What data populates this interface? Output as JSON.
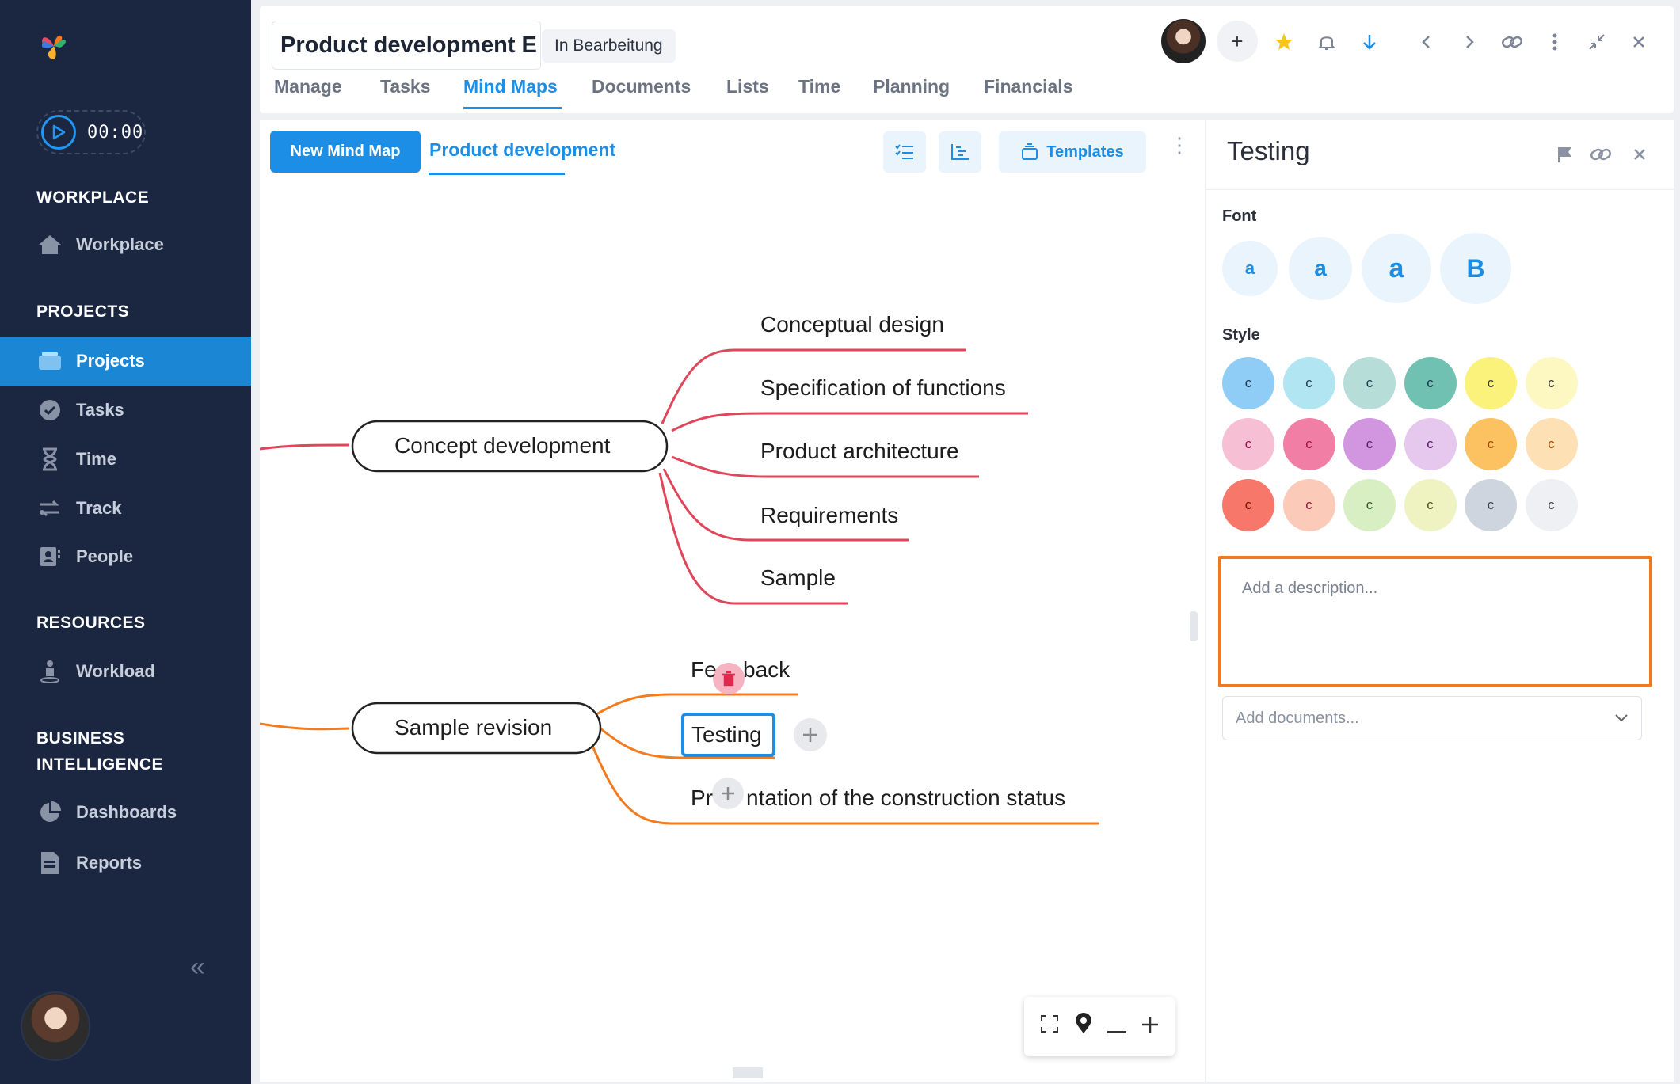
{
  "sidebar": {
    "timer": "00:00",
    "sections": {
      "workplace": "WORKPLACE",
      "projects": "PROJECTS",
      "resources": "RESOURCES",
      "bi_line1": "BUSINESS",
      "bi_line2": "INTELLIGENCE"
    },
    "items": {
      "workplace": "Workplace",
      "projects": "Projects",
      "tasks": "Tasks",
      "time": "Time",
      "track": "Track",
      "people": "People",
      "workload": "Workload",
      "dashboards": "Dashboards",
      "reports": "Reports"
    }
  },
  "header": {
    "project_title": "Product development E",
    "status": "In Bearbeitung",
    "tabs": [
      "Manage",
      "Tasks",
      "Mind Maps",
      "Documents",
      "Lists",
      "Time",
      "Planning",
      "Financials"
    ],
    "active_tab": "Mind Maps"
  },
  "canvas": {
    "new_button": "New Mind Map",
    "map_tab": "Product development",
    "templates_button": "Templates",
    "nodes": {
      "concept": "Concept development",
      "conceptual_design": "Conceptual design",
      "spec_functions": "Specification of functions",
      "product_arch": "Product architecture",
      "requirements": "Requirements",
      "sample": "Sample",
      "sample_revision": "Sample revision",
      "feedback_a": "Fe",
      "feedback_b": "back",
      "testing": "Testing",
      "presentation_a": "Pr",
      "presentation_b": "ntation of the construction status"
    }
  },
  "panel": {
    "title": "Testing",
    "font_label": "Font",
    "font_options": [
      "a",
      "a",
      "a",
      "B"
    ],
    "style_label": "Style",
    "style_letter": "c",
    "style_colors": [
      "#90cdf6",
      "#b2e5f2",
      "#b6ddd8",
      "#70c1b2",
      "#fbf27b",
      "#fdf7c2",
      "#f7bfd4",
      "#f17ea5",
      "#d295e0",
      "#e6c7ee",
      "#fcc160",
      "#fde0b4",
      "#f7776b",
      "#fccab9",
      "#d8efc4",
      "#eef3c1",
      "#cfd5de",
      "#eef0f3"
    ],
    "description_placeholder": "Add a description...",
    "documents_placeholder": "Add documents..."
  },
  "colors": {
    "accent": "#1c8ee6",
    "sidebar_bg": "#1b2640",
    "branch_red": "#e0465a",
    "branch_orange": "#f27a1f",
    "highlight_orange": "#f07a22"
  }
}
